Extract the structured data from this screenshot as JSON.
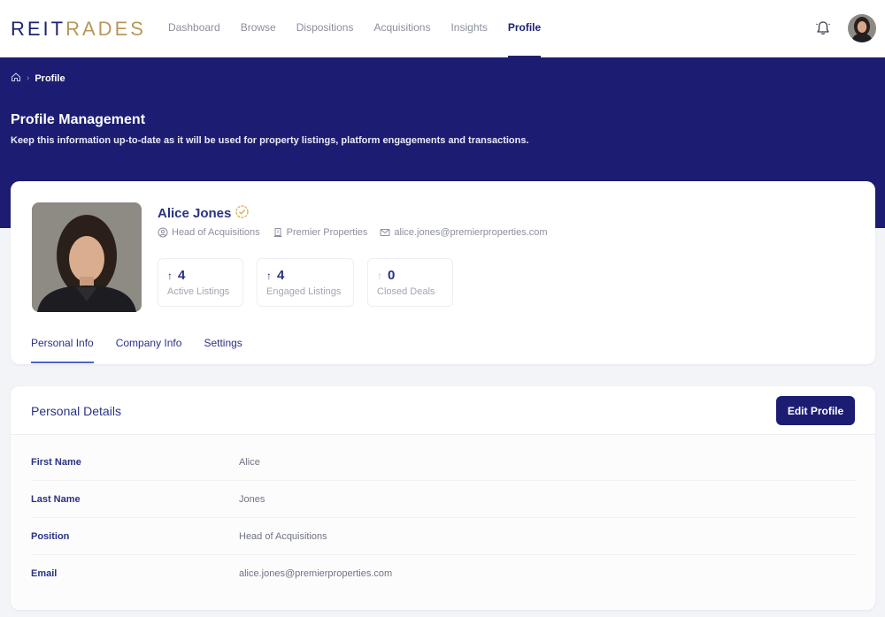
{
  "app": {
    "logo_part1": "REIT",
    "logo_part2": "RADES"
  },
  "nav": {
    "items": [
      {
        "label": "Dashboard"
      },
      {
        "label": "Browse"
      },
      {
        "label": "Dispositions"
      },
      {
        "label": "Acquisitions"
      },
      {
        "label": "Insights"
      },
      {
        "label": "Profile",
        "active": true
      }
    ]
  },
  "breadcrumb": {
    "current": "Profile"
  },
  "header": {
    "title": "Profile Management",
    "subtitle": "Keep this information up-to-date as it will be used for property listings, platform engagements and transactions."
  },
  "profile": {
    "name": "Alice Jones",
    "position": "Head of Acquisitions",
    "company": "Premier Properties",
    "email": "alice.jones@premierproperties.com",
    "stats": [
      {
        "value": "4",
        "label": "Active Listings"
      },
      {
        "value": "4",
        "label": "Engaged Listings"
      },
      {
        "value": "0",
        "label": "Closed Deals"
      }
    ]
  },
  "tabs": [
    {
      "label": "Personal Info",
      "active": true
    },
    {
      "label": "Company Info"
    },
    {
      "label": "Settings"
    }
  ],
  "details": {
    "title": "Personal Details",
    "edit_label": "Edit Profile",
    "fields": [
      {
        "label": "First Name",
        "value": "Alice"
      },
      {
        "label": "Last Name",
        "value": "Jones"
      },
      {
        "label": "Position",
        "value": "Head of Acquisitions"
      },
      {
        "label": "Email",
        "value": "alice.jones@premierproperties.com"
      }
    ]
  },
  "colors": {
    "brand_navy": "#1c1d72",
    "brand_gold": "#b8975a",
    "accent_blue": "#4a63c9"
  }
}
